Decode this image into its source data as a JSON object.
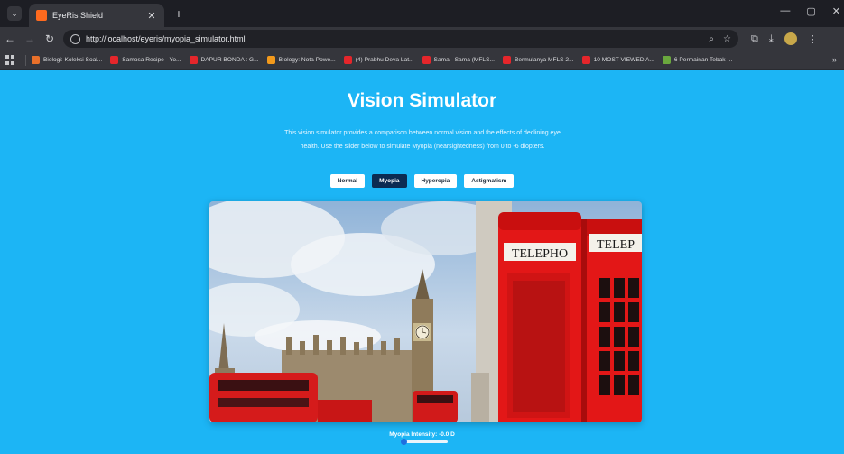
{
  "browser": {
    "tab_title": "EyeRis Shield",
    "tab_close": "✕",
    "new_tab": "+",
    "url": "http://localhost/eyeris/myopia_simulator.html",
    "window_controls": [
      "—",
      "▢",
      "✕"
    ],
    "bookmarks": [
      {
        "label": "Biologi: Koleksi Soal...",
        "color": "#e8702a"
      },
      {
        "label": "Samosa Recipe - Yo...",
        "color": "#e5262b"
      },
      {
        "label": "DAPUR BONDA : G...",
        "color": "#e5262b"
      },
      {
        "label": "Biology: Nota Powe...",
        "color": "#f39a1c"
      },
      {
        "label": "(4) Prabhu Deva Lat...",
        "color": "#e5262b"
      },
      {
        "label": "Sama - Sama (MFLS...",
        "color": "#e5262b"
      },
      {
        "label": "Bermulanya MFLS 2...",
        "color": "#e5262b"
      },
      {
        "label": "10 MOST VIEWED A...",
        "color": "#e5262b"
      },
      {
        "label": "6 Permainan Tebak-...",
        "color": "#6aa83e"
      }
    ],
    "bookmarks_more": "»"
  },
  "page": {
    "title": "Vision Simulator",
    "description": "This vision simulator provides a comparison between normal vision and the effects of declining eye health. Use the slider below to simulate Myopia (nearsightedness) from 0 to -6 diopters.",
    "modes": [
      {
        "label": "Normal",
        "active": false
      },
      {
        "label": "Myopia",
        "active": true
      },
      {
        "label": "Hyperopia",
        "active": false
      },
      {
        "label": "Astigmatism",
        "active": false
      }
    ],
    "scene_signs": [
      "TELEPHO",
      "TELEP"
    ],
    "intensity_label": "Myopia Intensity: -0.0 D",
    "slider_value": 0.0,
    "slider_min": 0,
    "slider_max": -6
  },
  "colors": {
    "page_bg": "#1cb5f5",
    "active_mode": "#0c2b52",
    "slider": "#1e6fe0"
  }
}
